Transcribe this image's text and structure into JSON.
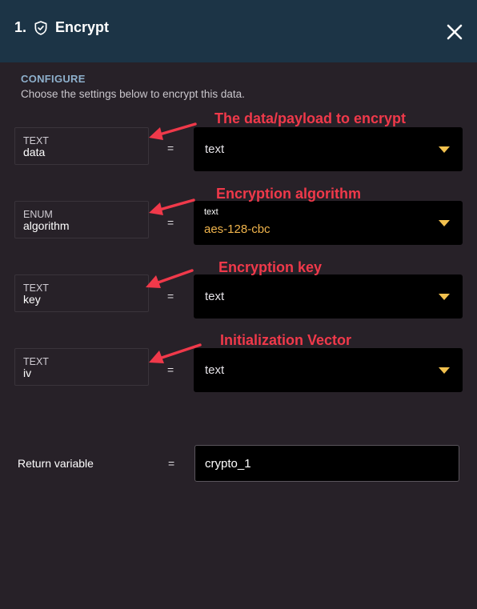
{
  "header": {
    "step": "1.",
    "title": "Encrypt",
    "icon": "shield-check-icon",
    "close_icon": "close-icon"
  },
  "configure": {
    "title": "CONFIGURE",
    "description": "Choose the settings below to encrypt this data."
  },
  "params": [
    {
      "type": "TEXT",
      "name": "data",
      "value": "text",
      "annotation": "The data/payload to encrypt"
    },
    {
      "type": "ENUM",
      "name": "algorithm",
      "value_type": "text",
      "value": "aes-128-cbc",
      "annotation": "Encryption algorithm"
    },
    {
      "type": "TEXT",
      "name": "key",
      "value": "text",
      "annotation": "Encryption key"
    },
    {
      "type": "TEXT",
      "name": "iv",
      "value": "text",
      "annotation": "Initialization Vector"
    }
  ],
  "equals": "=",
  "return": {
    "label": "Return variable",
    "value": "crypto_1"
  },
  "colors": {
    "header_bg": "#1c3446",
    "panel_bg": "#272128",
    "annotation": "#f0394a",
    "caret": "#f2c14e",
    "enum_value": "#f0b44c"
  }
}
